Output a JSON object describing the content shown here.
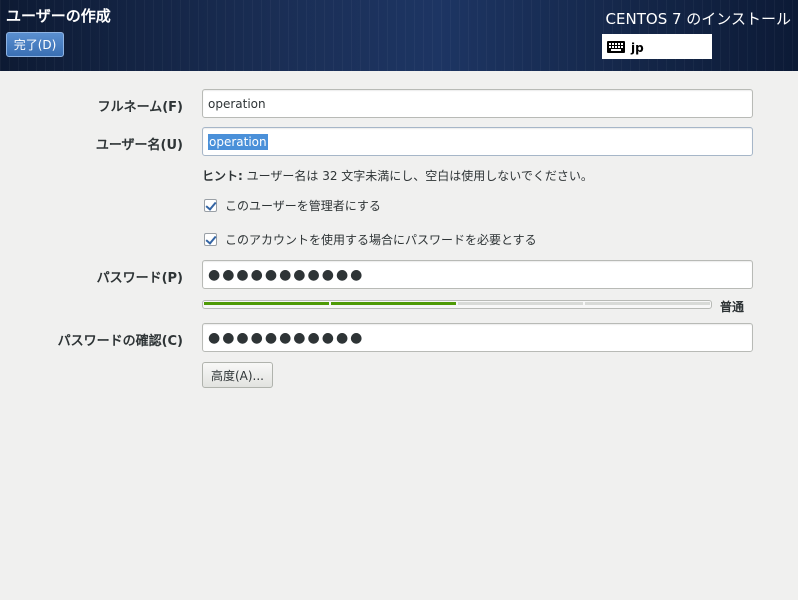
{
  "header": {
    "title": "ユーザーの作成",
    "done_label": "完了(D)",
    "install_title": "CENTOS 7 のインストール",
    "keyboard_layout": "jp"
  },
  "form": {
    "fullname": {
      "label": "フルネーム(F)",
      "value": "operation"
    },
    "username": {
      "label": "ユーザー名(U)",
      "value": "operation"
    },
    "hint_prefix": "ヒント:",
    "hint_text": " ユーザー名は 32 文字未満にし、空白は使用しないでください。",
    "admin_checkbox": {
      "label": "このユーザーを管理者にする",
      "checked": true
    },
    "require_password_checkbox": {
      "label": "このアカウントを使用する場合にパスワードを必要とする",
      "checked": true
    },
    "password": {
      "label": "パスワード(P)",
      "value": "●●●●●●●●●●●"
    },
    "strength": {
      "label": "普通",
      "level": 0.5
    },
    "confirm": {
      "label": "パスワードの確認(C)",
      "value": "●●●●●●●●●●●"
    },
    "advanced_label": "高度(A)..."
  }
}
